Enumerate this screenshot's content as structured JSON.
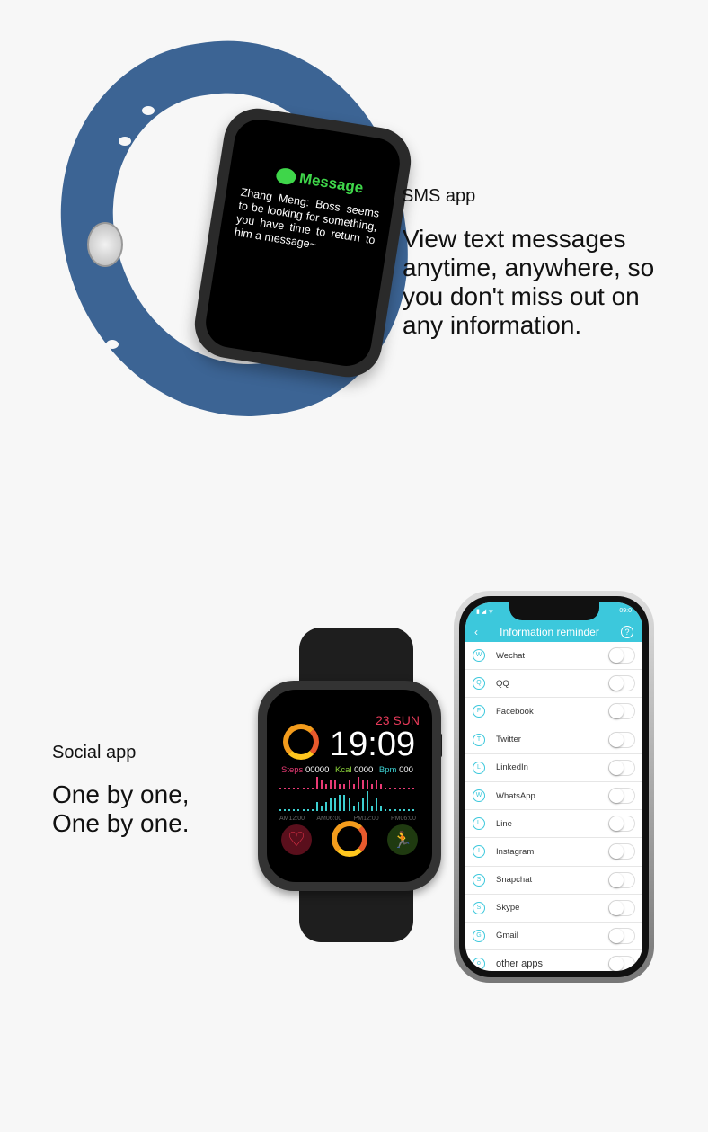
{
  "sms": {
    "watch_app": "Message",
    "watch_message": "Zhang Meng: Boss seems to be looking for something, you have time to return to him a message~",
    "label": "SMS app",
    "description": "View text messages anytime, anywhere, so you don't miss out on any information.",
    "band_color": "#3c6494"
  },
  "social": {
    "label": "Social app",
    "description_line1": "One by one,",
    "description_line2": "One by one."
  },
  "watch_face": {
    "date": "23 SUN",
    "time": "19:09",
    "steps_label": "Steps",
    "steps_value": "00000",
    "kcal_label": "Kcal",
    "kcal_value": "0000",
    "bpm_label": "Bpm",
    "bpm_value": "000",
    "time_marks": [
      "AM12:00",
      "AM06:00",
      "PM12:00",
      "PM06:00"
    ],
    "steps_bars": [
      0,
      0,
      0,
      0,
      0,
      0,
      0,
      0,
      3,
      2,
      1,
      2,
      2,
      1,
      1,
      2,
      1,
      3,
      2,
      2,
      1,
      2,
      1,
      0,
      0,
      0,
      0,
      0,
      0,
      0
    ],
    "bpm_bars": [
      0,
      0,
      0,
      0,
      0,
      0,
      0,
      0,
      2,
      1,
      2,
      3,
      3,
      4,
      4,
      3,
      1,
      2,
      3,
      5,
      1,
      3,
      1,
      0,
      0,
      0,
      0,
      0,
      0,
      0
    ]
  },
  "phone": {
    "status_time": "09:0",
    "title": "Information reminder",
    "accent": "#3cc8dc",
    "apps": [
      {
        "name": "Wechat",
        "icon": "wechat-icon",
        "enabled": false
      },
      {
        "name": "QQ",
        "icon": "qq-icon",
        "enabled": false
      },
      {
        "name": "Facebook",
        "icon": "facebook-icon",
        "enabled": false
      },
      {
        "name": "Twitter",
        "icon": "twitter-icon",
        "enabled": false
      },
      {
        "name": "LinkedIn",
        "icon": "linkedin-icon",
        "enabled": false
      },
      {
        "name": "WhatsApp",
        "icon": "whatsapp-icon",
        "enabled": false
      },
      {
        "name": "Line",
        "icon": "line-icon",
        "enabled": false
      },
      {
        "name": "Instagram",
        "icon": "instagram-icon",
        "enabled": false
      },
      {
        "name": "Snapchat",
        "icon": "snapchat-icon",
        "enabled": false
      },
      {
        "name": "Skype",
        "icon": "skype-icon",
        "enabled": false
      },
      {
        "name": "Gmail",
        "icon": "gmail-icon",
        "enabled": false
      },
      {
        "name": "other apps",
        "icon": "other-apps-icon",
        "enabled": false
      }
    ]
  }
}
